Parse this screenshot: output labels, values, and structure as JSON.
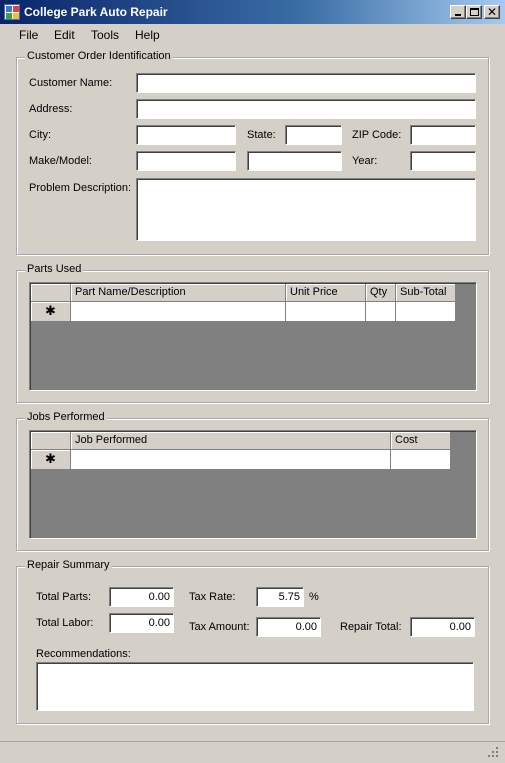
{
  "window": {
    "title": "College Park Auto Repair"
  },
  "menu": {
    "file": "File",
    "edit": "Edit",
    "tools": "Tools",
    "help": "Help"
  },
  "customer_order": {
    "legend": "Customer Order Identification",
    "customer_name_label": "Customer Name:",
    "address_label": "Address:",
    "city_label": "City:",
    "state_label": "State:",
    "zip_label": "ZIP Code:",
    "make_model_label": "Make/Model:",
    "year_label": "Year:",
    "problem_label": "Problem Description:"
  },
  "parts_used": {
    "legend": "Parts Used",
    "columns": [
      "Part Name/Description",
      "Unit Price",
      "Qty",
      "Sub-Total"
    ],
    "new_row_marker": "✱"
  },
  "jobs_performed": {
    "legend": "Jobs Performed",
    "columns": [
      "Job Performed",
      "Cost"
    ],
    "new_row_marker": "✱"
  },
  "repair_summary": {
    "legend": "Repair Summary",
    "total_parts_label": "Total Parts:",
    "total_parts_value": "0.00",
    "total_labor_label": "Total Labor:",
    "total_labor_value": "0.00",
    "tax_rate_label": "Tax Rate:",
    "tax_rate_value": "5.75",
    "tax_rate_unit": "%",
    "tax_amount_label": "Tax Amount:",
    "tax_amount_value": "0.00",
    "repair_total_label": "Repair Total:",
    "repair_total_value": "0.00",
    "recommendations_label": "Recommendations:"
  }
}
